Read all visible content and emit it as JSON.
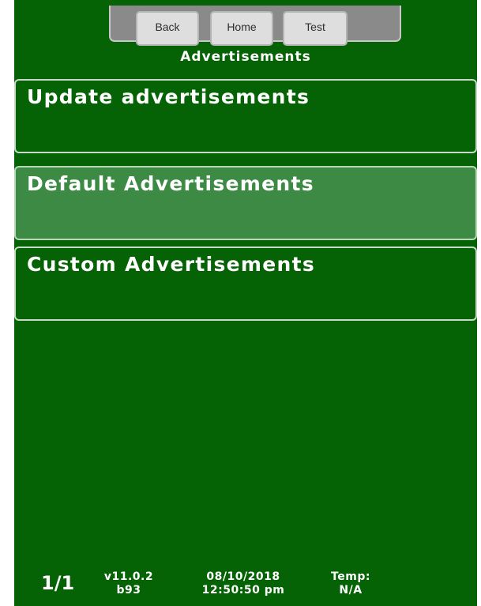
{
  "nav": {
    "back_label": "Back",
    "home_label": "Home",
    "test_label": "Test"
  },
  "page_title": "Advertisements",
  "menu": {
    "items": [
      {
        "label": "Update advertisements",
        "selected": false
      },
      {
        "label": "Default Advertisements",
        "selected": true
      },
      {
        "label": "Custom Advertisements",
        "selected": false
      }
    ]
  },
  "footer": {
    "page_count": "1/1",
    "version": "v11.0.2",
    "build": "b93",
    "date": "08/10/2018",
    "time": "12:50:50 pm",
    "temp_label": "Temp:",
    "temp_value": "N/A"
  },
  "colors": {
    "background": "#056305",
    "selected_item": "#3d8a45",
    "topbar": "#8a8a8a",
    "nav_button": "#dedede"
  }
}
